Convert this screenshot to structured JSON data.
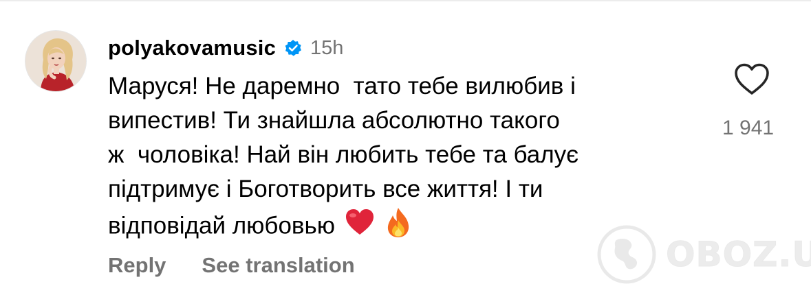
{
  "comment": {
    "username": "polyakovamusic",
    "verified_icon": "verified-badge-icon",
    "time": "15h",
    "text_lines": [
      "Маруся! Не даремно  тато тебе вилюбив і",
      "випестив! Ти знайшла абсолютно такого",
      "ж  чоловіка! Най він любить тебе та балує",
      "підтримує і Боготворить все життя! І ти",
      "відповідай любовью"
    ],
    "emojis": [
      "❤️",
      "🔥"
    ],
    "likes": "1 941",
    "like_icon": "heart-outline-icon",
    "actions": {
      "reply": "Reply",
      "see_translation": "See translation"
    }
  },
  "watermark": {
    "text": "OBOZ.UA",
    "icon": "globe-icon"
  },
  "colors": {
    "verified": "#0095f6",
    "secondary_text": "#737373",
    "heart_emoji": "#e0243a"
  }
}
